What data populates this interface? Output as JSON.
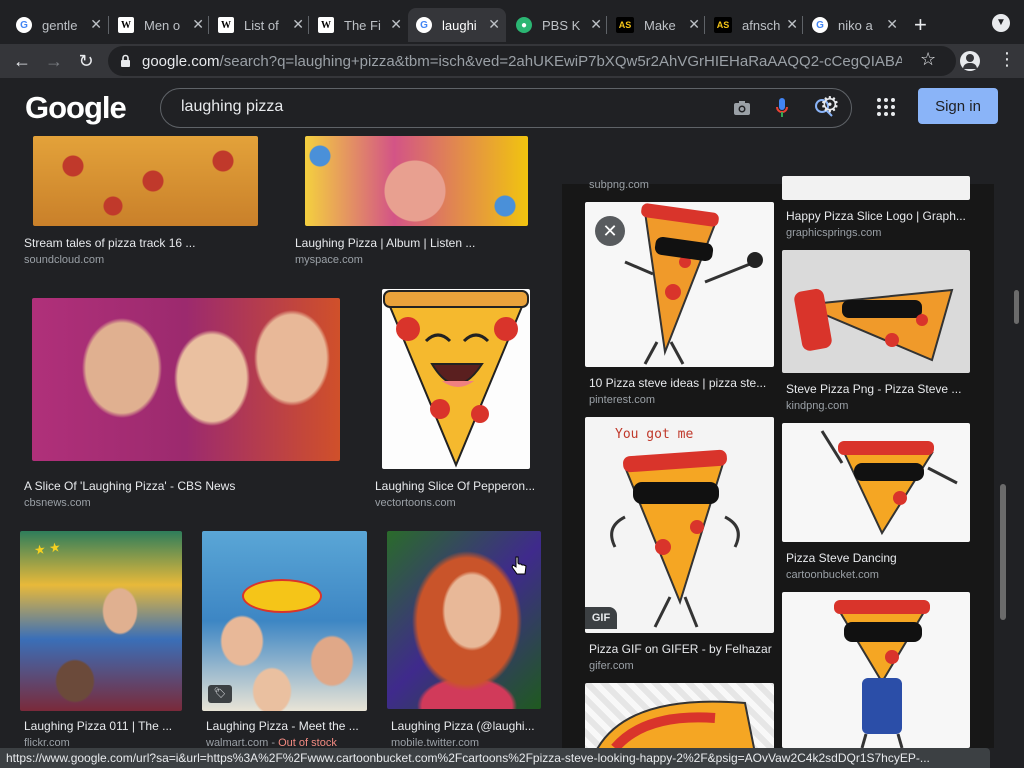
{
  "tabs": [
    {
      "title": "gentle",
      "favicon": "google-icon"
    },
    {
      "title": "Men o",
      "favicon": "wikipedia-icon"
    },
    {
      "title": "List of",
      "favicon": "wikipedia-icon"
    },
    {
      "title": "The Fi",
      "favicon": "wikipedia-icon"
    },
    {
      "title": "laughi",
      "favicon": "google-icon"
    },
    {
      "title": "PBS K",
      "favicon": "pbs-kids-icon"
    },
    {
      "title": "Make",
      "favicon": "as-icon"
    },
    {
      "title": "afnsch",
      "favicon": "as-icon"
    },
    {
      "title": "niko a",
      "favicon": "google-icon"
    }
  ],
  "address_bar": {
    "domain": "google.com",
    "path": "/search?q=laughing+pizza&tbm=isch&ved=2ahUKEwiP7bXQw5r2AhVGrHIEHaRaAAQQ2-cCegQIABAA&..."
  },
  "search": {
    "query": "laughing pizza"
  },
  "header": {
    "logo": "Google",
    "signin_label": "Sign in"
  },
  "results_left": [
    {
      "caption": "Stream tales of pizza track 16 ...",
      "source": "soundcloud.com"
    },
    {
      "caption": "Laughing Pizza | Album | Listen ...",
      "source": "myspace.com"
    },
    {
      "caption": "A Slice Of 'Laughing Pizza' - CBS News",
      "source": "cbsnews.com"
    },
    {
      "caption": "Laughing Slice Of Pepperon...",
      "source": "vectortoons.com"
    },
    {
      "caption": "Laughing Pizza 011 | The ...",
      "source": "flickr.com"
    },
    {
      "caption": "Laughing Pizza - Meet the ...",
      "source": "walmart.com",
      "stock": "Out of stock"
    },
    {
      "caption": "Laughing Pizza (@laughi...",
      "source": "mobile.twitter.com"
    }
  ],
  "results_right": [
    {
      "caption": "",
      "source": "subpng.com"
    },
    {
      "caption": "Happy Pizza Slice Logo | Graph...",
      "source": "graphicsprings.com"
    },
    {
      "caption": "10 Pizza steve ideas | pizza ste...",
      "source": "pinterest.com"
    },
    {
      "caption": "Steve Pizza Png - Pizza Steve ...",
      "source": "kindpng.com"
    },
    {
      "caption": "Pizza GIF on GIFER - by Felhazar",
      "source": "gifer.com",
      "badge": "GIF",
      "overlay_text": "You got me"
    },
    {
      "caption": "Pizza Steve Dancing",
      "source": "cartoonbucket.com"
    },
    {
      "caption": "",
      "source": ""
    },
    {
      "caption": "",
      "source": ""
    }
  ],
  "status_bar": {
    "url": "https://www.google.com/url?sa=i&url=https%3A%2F%2Fwww.cartoonbucket.com%2Fcartoons%2Fpizza-steve-looking-happy-2%2F&psig=AOvVaw2C4k2sdDQr1S7hcyEP-..."
  },
  "colors": {
    "accent": "#8ab4f8",
    "background": "#202124",
    "stock_warning": "#f28b82"
  }
}
